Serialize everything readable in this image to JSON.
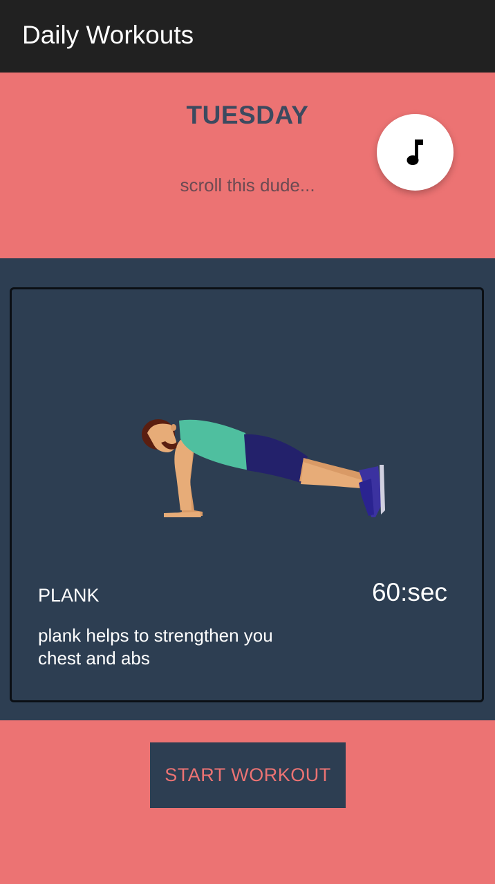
{
  "toolbar": {
    "title": "Daily Workouts"
  },
  "header": {
    "day": "TUESDAY",
    "subtitle": "scroll this dude...",
    "music_button_icon": "music-note-icon"
  },
  "exercise": {
    "name": "PLANK",
    "duration": "60:sec",
    "description": "plank helps to strengthen you chest and abs",
    "illustration": "plank-figure"
  },
  "footer": {
    "start_label": "START WORKOUT"
  },
  "colors": {
    "accent": "#EC7373",
    "dark": "#2D3E52",
    "toolbar": "#212121"
  }
}
